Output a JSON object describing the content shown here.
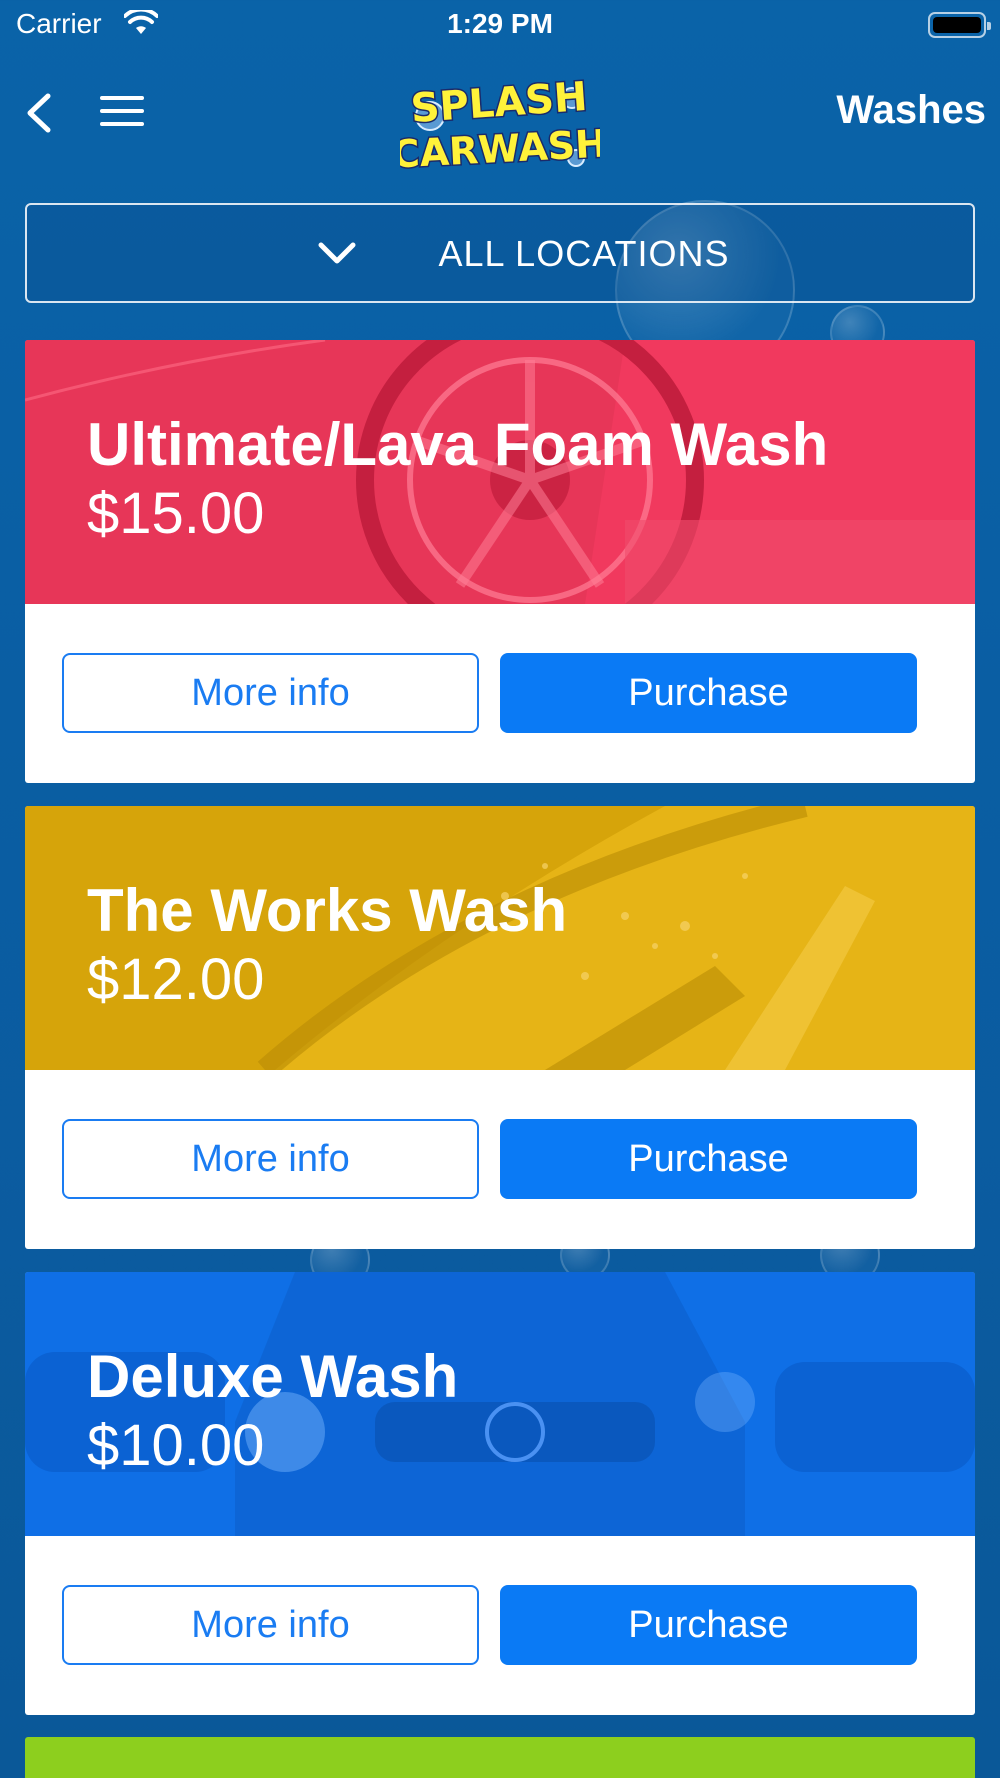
{
  "status_bar": {
    "carrier": "Carrier",
    "time": "1:29 PM"
  },
  "nav": {
    "title": "Washes",
    "logo_line1": "SPLASH",
    "logo_line2": "CARWASH"
  },
  "location_select": {
    "label": "ALL LOCATIONS"
  },
  "washes": [
    {
      "name": "Ultimate/Lava Foam Wash",
      "price": "$15.00",
      "more_label": "More info",
      "purchase_label": "Purchase",
      "color": "#f1395e"
    },
    {
      "name": "The Works Wash",
      "price": "$12.00",
      "more_label": "More info",
      "purchase_label": "Purchase",
      "color": "#e3ad0c"
    },
    {
      "name": "Deluxe Wash",
      "price": "$10.00",
      "more_label": "More info",
      "purchase_label": "Purchase",
      "color": "#0f6fe6"
    }
  ],
  "colors": {
    "accent": "#0a7af5",
    "background": "#0a5ea3",
    "partial_card": "#8dcf1e"
  }
}
